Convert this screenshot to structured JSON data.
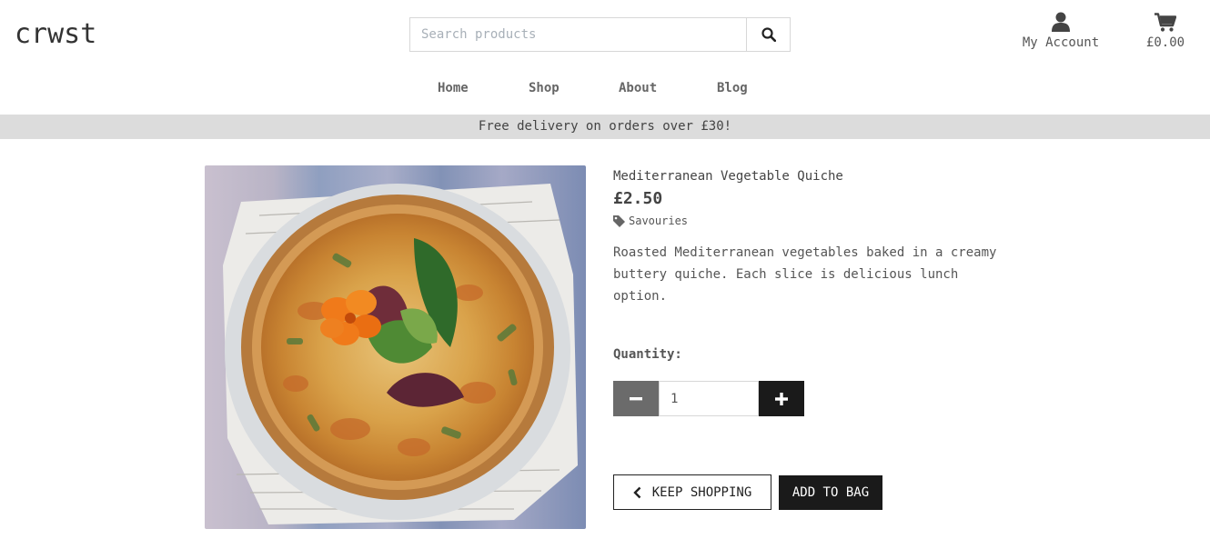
{
  "header": {
    "logo": "crwst",
    "search": {
      "placeholder": "Search products",
      "value": ""
    },
    "account_label": "My Account",
    "cart_total": "£0.00"
  },
  "nav": {
    "items": [
      "Home",
      "Shop",
      "About",
      "Blog"
    ]
  },
  "banner": {
    "text": "Free delivery on orders over £30!"
  },
  "product": {
    "name": "Mediterranean Vegetable Quiche",
    "price": "£2.50",
    "category": "Savouries",
    "description": "Roasted Mediterranean vegetables baked in a creamy buttery quiche. Each slice is delicious lunch option."
  },
  "quantity": {
    "label": "Quantity:",
    "value": "1"
  },
  "buttons": {
    "keep_shopping": "KEEP SHOPPING",
    "add_to_bag": "ADD TO BAG"
  },
  "icons": {
    "search": "search-icon",
    "account": "user-icon",
    "cart": "shopping-cart-icon",
    "category": "tag-icon",
    "minus": "minus-icon",
    "plus": "plus-icon",
    "back": "chevron-left-icon"
  },
  "colors": {
    "dark": "#1a1a1a",
    "banner": "#dcdcdc",
    "minus_button": "#6b6b6b"
  }
}
